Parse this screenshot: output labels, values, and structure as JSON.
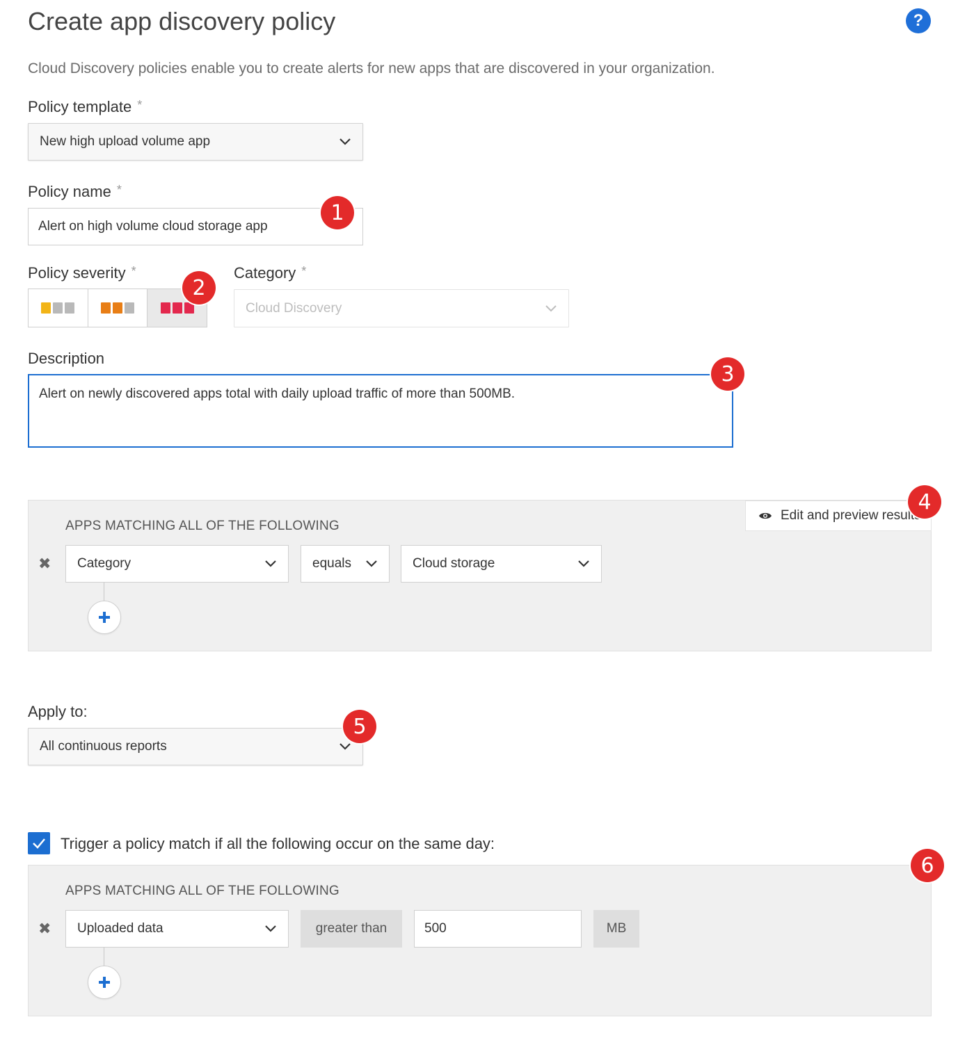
{
  "header": {
    "title": "Create app discovery policy",
    "help_icon": "?"
  },
  "intro": "Cloud Discovery policies enable you to create alerts for new apps that are discovered in your organization.",
  "form": {
    "policy_template": {
      "label": "Policy template",
      "required": "*",
      "value": "New high upload volume app"
    },
    "policy_name": {
      "label": "Policy name",
      "required": "*",
      "value": "Alert on high volume cloud storage app"
    },
    "policy_severity": {
      "label": "Policy severity",
      "required": "*",
      "options": [
        {
          "name": "low",
          "colors": [
            "#f2b417",
            "#b9b9b9",
            "#b9b9b9"
          ]
        },
        {
          "name": "medium",
          "colors": [
            "#e87e16",
            "#e87e16",
            "#b9b9b9"
          ]
        },
        {
          "name": "high",
          "colors": [
            "#e3284d",
            "#e3284d",
            "#e3284d"
          ]
        }
      ],
      "selected": "high"
    },
    "category": {
      "label": "Category",
      "required": "*",
      "value": "Cloud Discovery"
    },
    "description": {
      "label": "Description",
      "value": "Alert on newly discovered apps total with daily upload traffic of more than 500MB."
    }
  },
  "filter_panel": {
    "title": "APPS MATCHING ALL OF THE FOLLOWING",
    "preview_button": "Edit and preview results",
    "remove_icon": "✖",
    "rule": {
      "field": "Category",
      "operator": "equals",
      "value": "Cloud storage"
    }
  },
  "apply_to": {
    "label": "Apply to:",
    "value": "All continuous reports"
  },
  "trigger": {
    "checked": true,
    "label": "Trigger a policy match if all the following occur on the same day:",
    "panel_title": "APPS MATCHING ALL OF THE FOLLOWING",
    "rule": {
      "field": "Uploaded data",
      "operator": "greater than",
      "value": "500",
      "unit": "MB"
    }
  },
  "badges": [
    "1",
    "2",
    "3",
    "4",
    "5",
    "6"
  ],
  "colors": {
    "accent": "#1c6ed1",
    "badge": "#e32a2a",
    "panel_bg": "#f0f0f0"
  }
}
